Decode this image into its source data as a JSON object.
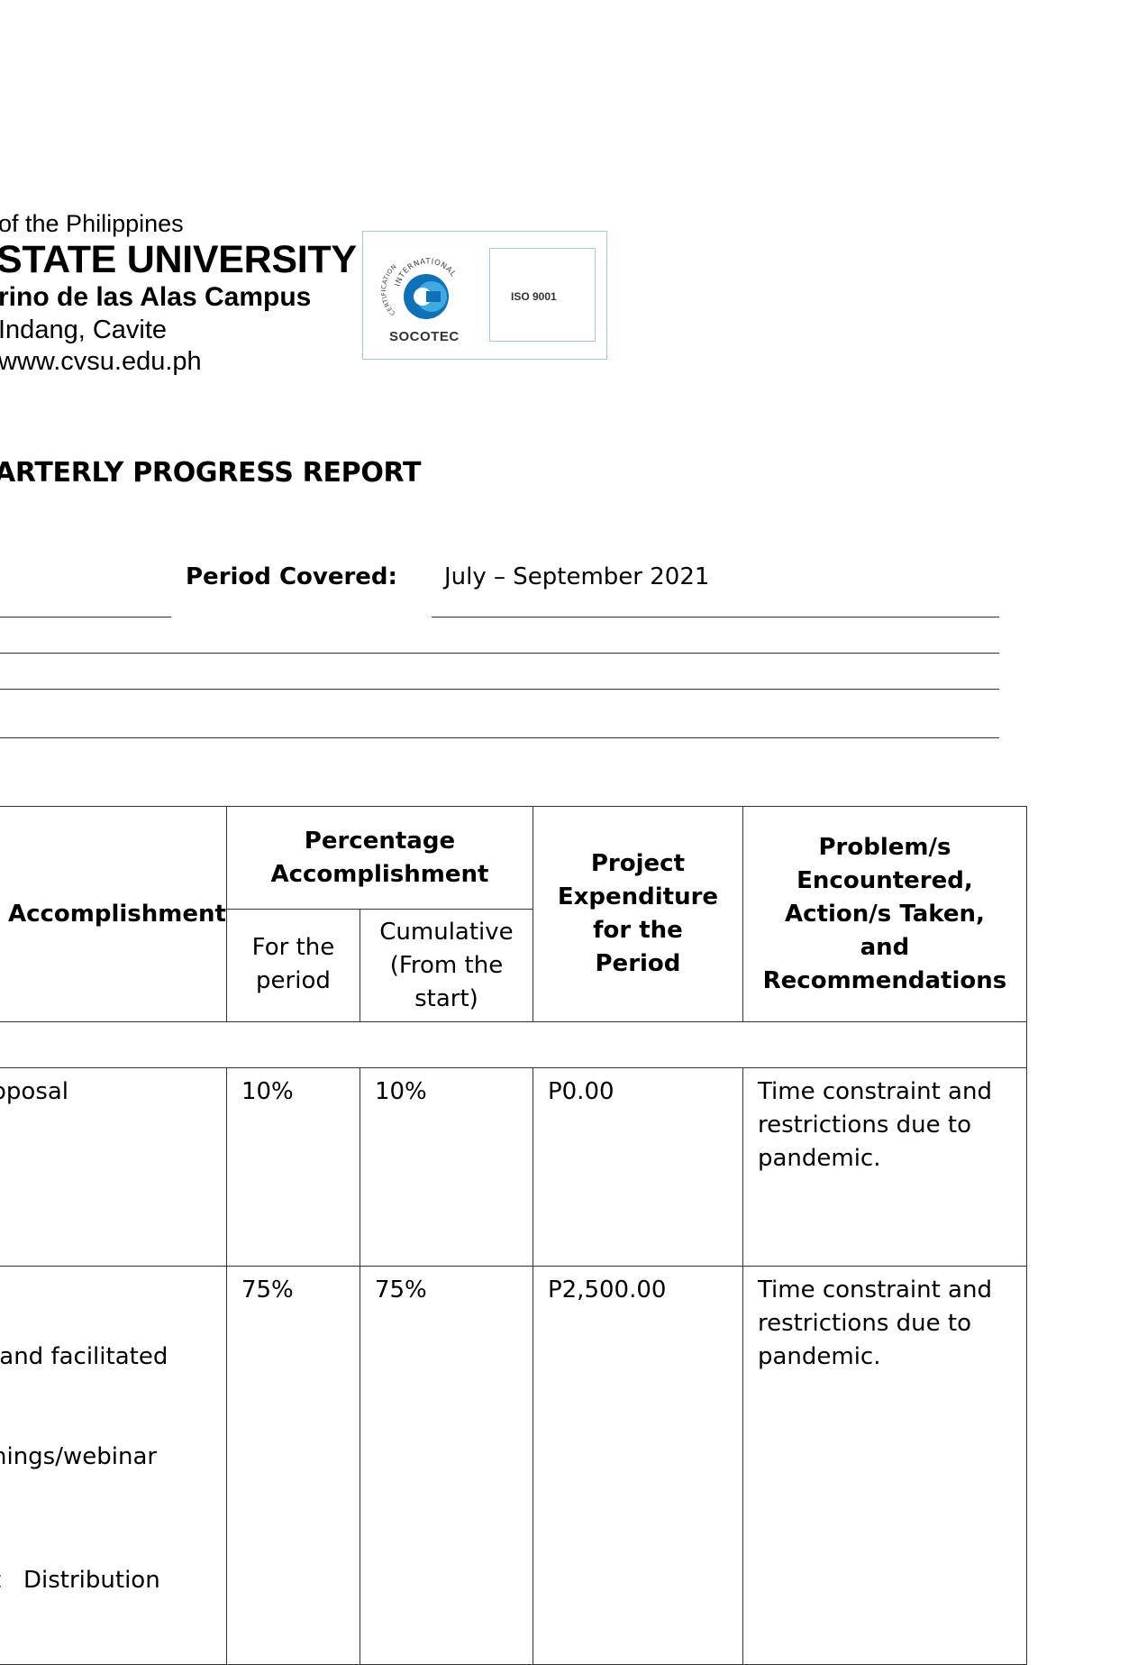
{
  "header": {
    "line1": "of the Philippines",
    "line2": "STATE UNIVERSITY",
    "line3": "rino de las Alas Campus",
    "line4": " Indang, Cavite",
    "line5": "www.cvsu.edu.ph"
  },
  "certification_logo": {
    "arc_text_left": "CERTIFICATION",
    "arc_text_top": "INTERNATIONAL",
    "brand": "SOCOTEC",
    "standard": "ISO 9001",
    "colors": {
      "dark_blue": "#0f72b8",
      "light_blue": "#3fa9e0",
      "frame": "#9fcbe0"
    }
  },
  "report": {
    "title": "ARTERLY PROGRESS REPORT",
    "period_label": "Period Covered:",
    "period_value": "July – September 2021"
  },
  "table": {
    "headers": {
      "accomplishment": "l Accomplishment",
      "percentage": "Percentage Accomplishment",
      "for_period": "For the period",
      "cumulative": "Cumulative (From the start)",
      "expenditure": "Project Expenditure for the Period",
      "problems": "Problem/s Encountered, Action/s Taken, and Recommendations"
    },
    "rows": [
      {
        "accomplishment_line1": "oposal",
        "accomplishment_line2": "",
        "for_period": "10%",
        "cumulative": "10%",
        "expenditure": "P0.00",
        "problems": "Time constraint and restrictions due to pandemic."
      },
      {
        "accomplishment_line1": " and facilitated",
        "accomplishment_line2": "nings/webinar",
        "accomplishment_line3": "t   Distribution",
        "for_period": "75%",
        "cumulative": "75%",
        "expenditure": "P2,500.00",
        "problems": "Time constraint and restrictions due to pandemic."
      }
    ]
  }
}
